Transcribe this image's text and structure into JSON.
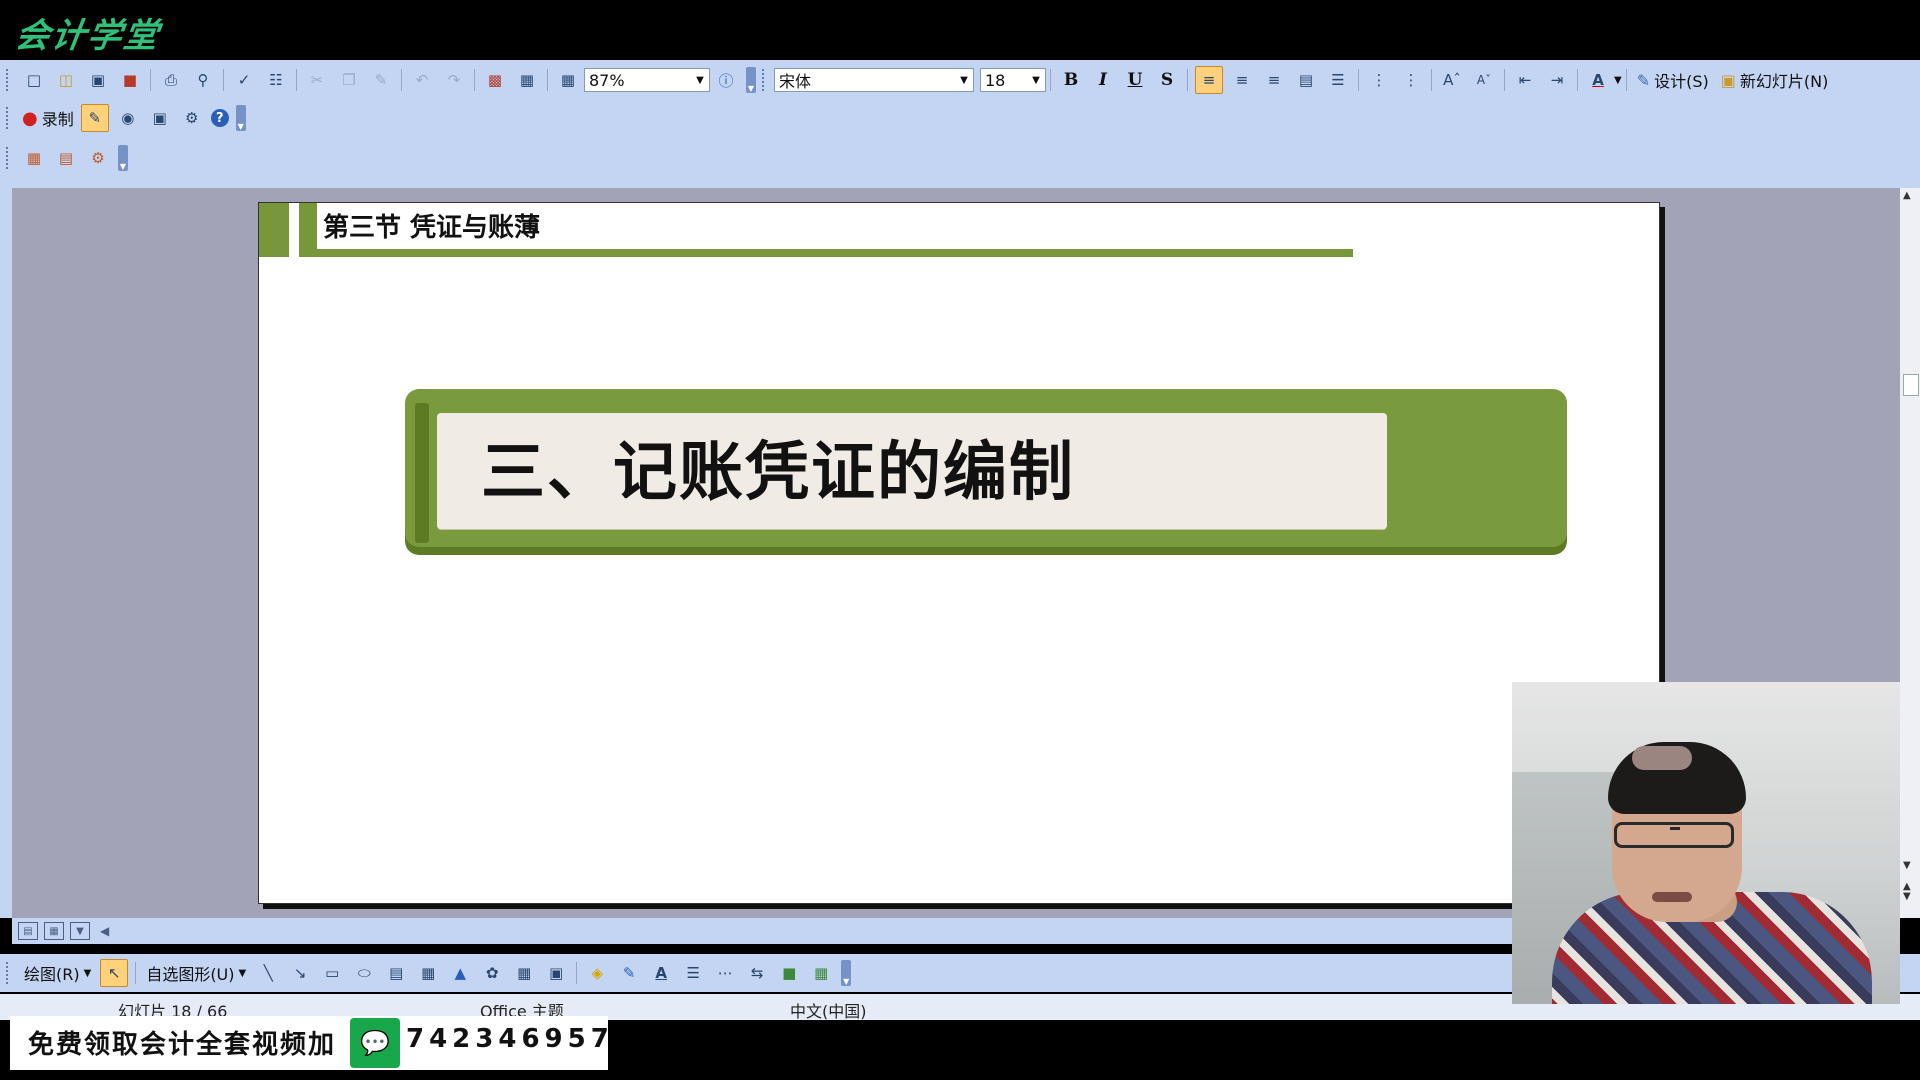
{
  "logo": {
    "text": "会计学堂"
  },
  "toolbar_standard": {
    "zoom": "87%",
    "icons": [
      "new-icon",
      "open-icon",
      "save-icon",
      "permission-icon",
      "print-icon",
      "print-preview-icon",
      "spelling-icon",
      "research-icon",
      "cut-icon",
      "copy-icon",
      "format-painter-icon",
      "undo-icon",
      "redo-icon",
      "insert-chart-icon",
      "insert-table-icon",
      "grid-icon",
      "help-icon"
    ]
  },
  "toolbar_formatting": {
    "font_name": "宋体",
    "font_size": "18",
    "bold": "B",
    "italic": "I",
    "underline": "U",
    "shadow": "S",
    "design_label": "设计(S)",
    "new_slide_label": "新幻灯片(N)"
  },
  "toolbar_record": {
    "record_label": "录制"
  },
  "slide": {
    "section_title": "第三节 凭证与账薄",
    "banner_title": "三、记账凭证的编制"
  },
  "drawing_toolbar": {
    "draw_menu": "绘图(R)",
    "autoshapes_menu": "自选图形(U)"
  },
  "status_bar": {
    "slide_info": "幻灯片 18 / 66",
    "theme": "Office 主题",
    "language": "中文(中国)"
  },
  "promo": {
    "text": "免费领取会计全套视频加",
    "wechat_number": "742346957"
  },
  "colors": {
    "slide_green": "#77973a",
    "toolbar_blue": "#c3d5f2",
    "workspace_gray": "#a3a3b8",
    "logo_green": "#2fc07a"
  }
}
